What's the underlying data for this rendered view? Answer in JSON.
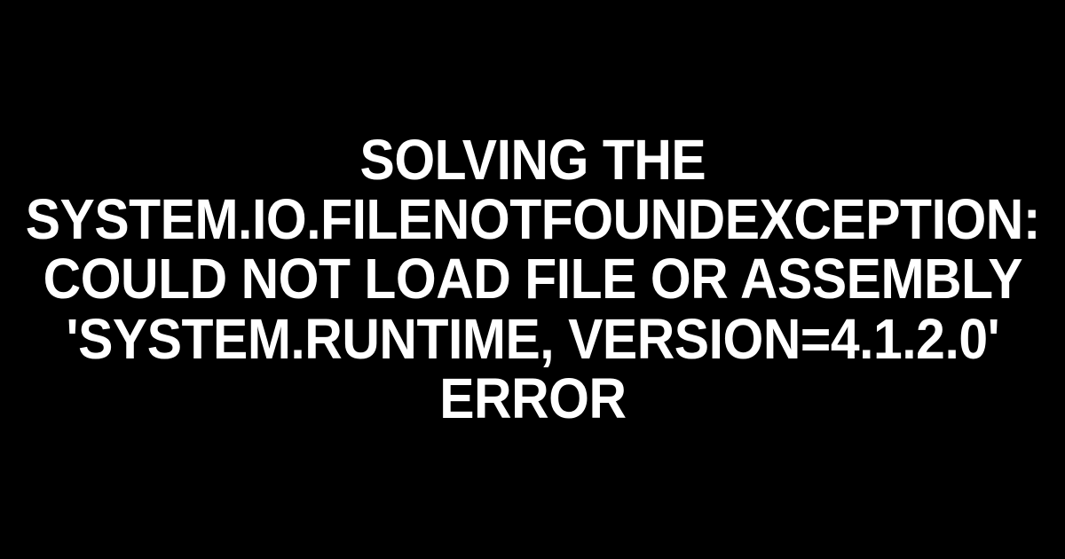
{
  "title": "Solving the System.IO.FileNotFoundException: Could not load file or assembly 'System.Runtime, Version=4.1.2.0' error"
}
